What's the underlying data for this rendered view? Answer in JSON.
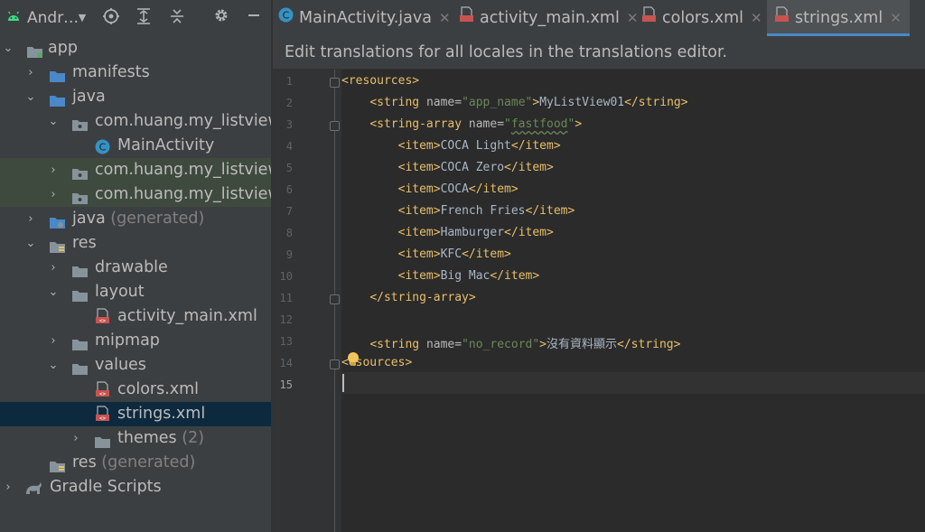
{
  "toolbar": {
    "project_view": "Andr…"
  },
  "tree": {
    "app": "app",
    "manifests": "manifests",
    "java": "java",
    "pkg_main": "com.huang.my_listview",
    "main_activity": "MainActivity",
    "pkg_android_test": "com.huang.my_listview",
    "pkg_test": "com.huang.my_listview",
    "java_generated_name": "java",
    "java_generated_suffix": "(generated)",
    "res": "res",
    "drawable": "drawable",
    "layout": "layout",
    "activity_main": "activity_main.xml",
    "mipmap": "mipmap",
    "values": "values",
    "colors": "colors.xml",
    "strings": "strings.xml",
    "themes_name": "themes",
    "themes_suffix": "(2)",
    "res_generated_name": "res",
    "res_generated_suffix": "(generated)",
    "gradle_scripts": "Gradle Scripts"
  },
  "tabs": [
    {
      "label": "MainActivity.java",
      "active": false
    },
    {
      "label": "activity_main.xml",
      "active": false
    },
    {
      "label": "colors.xml",
      "active": false
    },
    {
      "label": "strings.xml",
      "active": true
    }
  ],
  "notice": "Edit translations for all locales in the translations editor.",
  "editor": {
    "line_numbers": [
      "1",
      "2",
      "3",
      "4",
      "5",
      "6",
      "7",
      "8",
      "9",
      "10",
      "11",
      "12",
      "13",
      "14",
      "15"
    ],
    "l1": "<resources>",
    "l2_open": "<string ",
    "l2_attr": "name=",
    "l2_val": "\"app_name\"",
    "l2_gt": ">",
    "l2_text": "MyListView01",
    "l2_close": "</string>",
    "l3_open": "<string-array ",
    "l3_attr": "name=",
    "l3_q1": "\"",
    "l3_val": "fastfood",
    "l3_q2": "\"",
    "l3_gt": ">",
    "items": [
      "COCA Light",
      "COCA Zero",
      "COCA",
      "French Fries",
      "Hamburger",
      "KFC",
      "Big Mac"
    ],
    "item_open": "<item>",
    "item_close": "</item>",
    "l11": "</string-array>",
    "l13_open": "<string ",
    "l13_attr": "name=",
    "l13_val": "\"no_record\"",
    "l13_gt": ">",
    "l13_text": "沒有資料顯示",
    "l13_close": "</string>",
    "l14_lt": "<",
    "l14_rest": "esources>"
  }
}
